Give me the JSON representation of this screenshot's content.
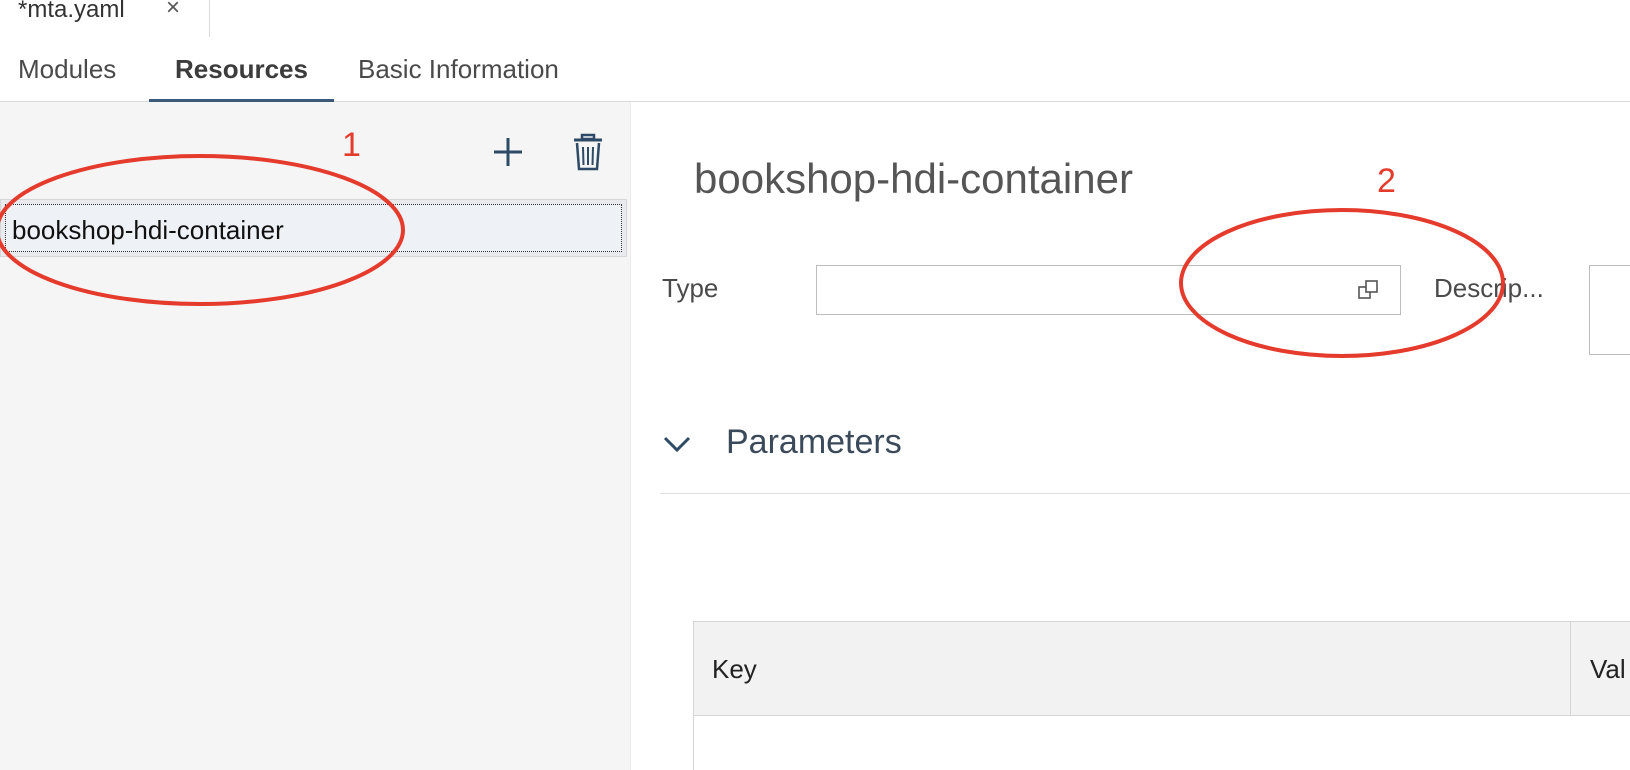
{
  "file_tab": {
    "label": "*mta.yaml",
    "close_glyph": "×"
  },
  "subtabs": [
    {
      "label": "Modules",
      "selected": false
    },
    {
      "label": "Resources",
      "selected": true
    },
    {
      "label": "Basic Information",
      "selected": false
    }
  ],
  "list": {
    "add_icon": "plus-icon",
    "delete_icon": "trash-icon",
    "items": [
      {
        "label": "bookshop-hdi-container",
        "selected": true
      }
    ]
  },
  "detail": {
    "title": "bookshop-hdi-container",
    "type_label": "Type",
    "type_value": "",
    "value_help_icon": "value-help-icon",
    "description_label": "Descrip...",
    "description_value": ""
  },
  "parameters": {
    "title": "Parameters",
    "expanded": true,
    "columns": [
      "Key",
      "Val"
    ]
  },
  "annotations": {
    "marker_1": "1",
    "marker_2": "2",
    "color": "#e53b2c"
  },
  "colors": {
    "accent": "#3b5a7a",
    "panel_bg": "#f5f5f5"
  }
}
